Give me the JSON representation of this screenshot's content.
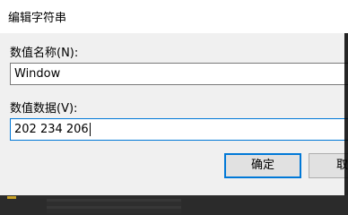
{
  "dialog": {
    "title": "编辑字符串",
    "value_name_label": "数值名称(N):",
    "value_name": "Window",
    "value_data_label": "数值数据(V):",
    "value_data": "202 234 206",
    "ok_label": "确定",
    "cancel_label": "取"
  },
  "colors": {
    "dialog_bg": "#f0f0f0",
    "focus_border": "#0078d7",
    "button_bg": "#e1e1e1"
  }
}
